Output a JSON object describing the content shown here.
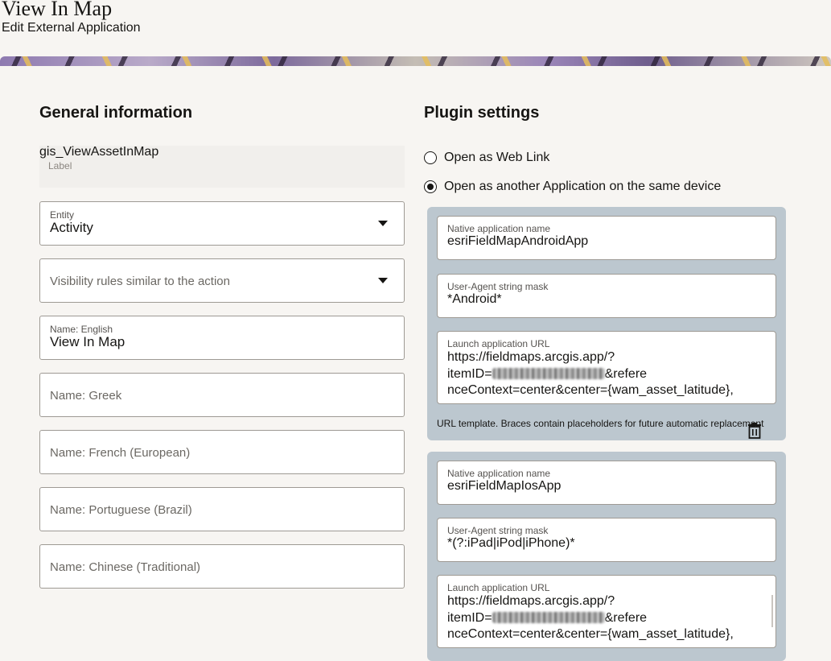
{
  "header": {
    "title": "View In Map",
    "subtitle": "Edit External Application"
  },
  "general": {
    "heading": "General information",
    "label_field": {
      "value": "gis_ViewAssetInMap",
      "caption": "Label"
    },
    "entity": {
      "label": "Entity",
      "value": "Activity"
    },
    "visibility": {
      "placeholder": "Visibility rules similar to the action"
    },
    "name_english": {
      "label": "Name: English",
      "value": "View In Map"
    },
    "name_greek": {
      "placeholder": "Name: Greek"
    },
    "name_french": {
      "placeholder": "Name: French (European)"
    },
    "name_portuguese": {
      "placeholder": "Name: Portuguese (Brazil)"
    },
    "name_chinese": {
      "placeholder": "Name: Chinese (Traditional)"
    }
  },
  "plugin": {
    "heading": "Plugin settings",
    "options": [
      {
        "label": "Open as Web Link",
        "selected": false
      },
      {
        "label": "Open as another Application on the same device",
        "selected": true
      }
    ],
    "apps": [
      {
        "native_label": "Native application name",
        "native_value": "esriFieldMapAndroidApp",
        "agent_label": "User-Agent string mask",
        "agent_value": "*Android*",
        "url_label": "Launch application URL",
        "url_line1": "https://fieldmaps.arcgis.app/?",
        "url_line2_prefix": "itemID=",
        "url_line2_suffix": "&refere",
        "url_line3": "nceContext=center&center={wam_asset_latitude},",
        "hint": "URL template. Braces contain placeholders for future automatic replacement"
      },
      {
        "native_label": "Native application name",
        "native_value": "esriFieldMapIosApp",
        "agent_label": "User-Agent string mask",
        "agent_value": "*(?:iPad|iPod|iPhone)*",
        "url_label": "Launch application URL",
        "url_line1": "https://fieldmaps.arcgis.app/?",
        "url_line2_prefix": "itemID=",
        "url_line2_suffix": "&refere",
        "url_line3": "nceContext=center&center={wam_asset_latitude},"
      }
    ]
  },
  "icons": {
    "dropdown": "chevron-down-icon",
    "delete": "trash-icon"
  }
}
